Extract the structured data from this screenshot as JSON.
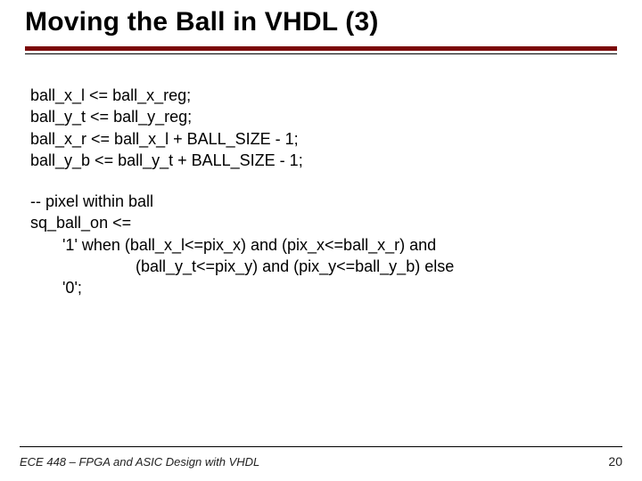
{
  "title": "Moving the Ball in VHDL (3)",
  "code_block1": [
    "ball_x_l <= ball_x_reg;",
    "ball_y_t <= ball_y_reg;",
    "ball_x_r <= ball_x_l + BALL_SIZE - 1;",
    "ball_y_b <= ball_y_t + BALL_SIZE - 1;"
  ],
  "code_block2": {
    "l1": "-- pixel within ball",
    "l2": "sq_ball_on <=",
    "l3": "'1' when (ball_x_l<=pix_x) and (pix_x<=ball_x_r) and",
    "l4": "(ball_y_t<=pix_y) and (pix_y<=ball_y_b) else",
    "l5": "'0';"
  },
  "footer": {
    "course": "ECE 448 – FPGA and ASIC Design with VHDL",
    "page": "20"
  }
}
